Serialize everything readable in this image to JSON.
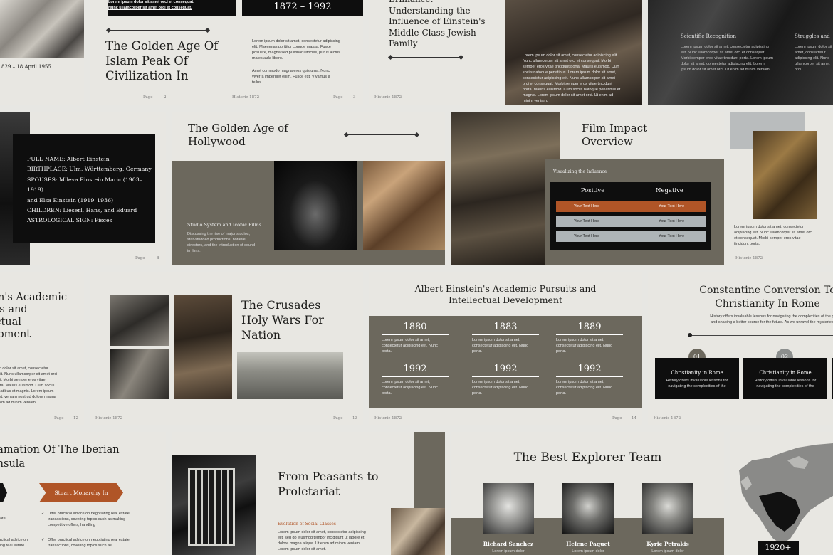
{
  "s1": {
    "date": "829 – 18 April 1955"
  },
  "s2": {
    "banner1": "Lorem ipsum dolor sit amet orci et consequat.",
    "banner2": "Nunc ullamcorper sit amet orci et consequat.",
    "title": "The Golden Age Of Islam Peak Of Civilization In",
    "page": "Page",
    "num": "2"
  },
  "s3": {
    "years": "1872 – 1992",
    "p1": "Lorem ipsum dolor sit amet, consectetur adipiscing elit. Maecenas porttitor congue massa. Fusce posuere, magna sed pulvinar ultricies, purus lectus malesuada libero.",
    "p2": "Amet commodo magna eros quis urna. Nunc viverra imperdiet enim. Fusce est. Vivamus a tellus.",
    "brand": "Historic 1872",
    "page": "Page",
    "num": "3"
  },
  "s4": {
    "title": "Brilliance: Understanding the Influence of Einstein's Middle-Class Jewish Family",
    "body": "Lorem ipsum dolor sit amet, consectetur adipiscing elit. Nunc ullamcorper sit amet orci et consequat. Morbi semper eros vitae tincidunt porta. Mauris euismod. Cum sociis natoque penatibus. Lorem ipsum dolor sit amet, consectetur adipiscing elit. Nunc ullamcorper sit amet orci et consequat. Morbi semper eros vitae tincidunt porta. Mauris euismod. Cum sociis natoque penatibus et magnis. Lorem ipsum dolor sit amet orci. Ut enim ad minim veniam.",
    "brand": "Historic 1872"
  },
  "s5": {
    "h1": "Scientific Recognition",
    "h2": "Struggles and",
    "b1": "Lorem ipsum dolor sit amet, consectetur adipiscing elit. Nunc ullamcorper sit amet orci et consequat. Morbi semper eros vitae tincidunt porta. Lorem ipsum dolor sit amet, consectetur adipiscing elit. Lorem ipsum dolor sit amet orci. Ut enim ad minim veniam.",
    "b2": "Lorem ipsum dolor sit amet, consectetur adipiscing elit. Nunc ullamcorper sit amet orci."
  },
  "s6": {
    "lines": [
      "FULL NAME: Albert Einstein",
      "BIRTHPLACE: Ulm, Württemberg, Germany",
      "SPOUSES:  Mileva Einstein Maric (1903–1919)",
      "and Elsa Einstein (1919–1936)",
      "CHILDREN: Lieserl, Hans, and Eduard",
      "ASTROLOGICAL SIGN: Pisces"
    ],
    "page": "Page",
    "num": "8"
  },
  "s7": {
    "title": "The Golden Age of Hollywood",
    "sub": "Studio System and Iconic Films",
    "body": "Discussing the rise of major studios, star-studded productions, notable directors, and the introduction of sound in films."
  },
  "s8": {
    "title": "Film Impact Overview",
    "label": "Visualizing the Influence",
    "pos": "Positive",
    "neg": "Negative",
    "cell": "Your Text Here"
  },
  "s9": {
    "body": "Lorem ipsum dolor sit amet, consectetur adipiscing elit. Nunc ullamcorper sit amet orci et consequat. Morbi semper eros vitae tincidunt porta.",
    "brand": "Historic 1872"
  },
  "s10": {
    "title": "Einstein's Academic Pursuits and Intellectual Development",
    "body": "Lorem ipsum dolor sit amet, consectetur adipiscing elit. Nunc ullamcorper sit amet orci et consequat. Morbi semper eros vitae tincidunt porta. Mauris euismod. Cum sociis natoque penatibus et magnis. Lorem ipsum dolor sit amet, veniam nostrud dolore magna aliqua. Ut enim ad minim veniam.",
    "page": "Page",
    "num": "12"
  },
  "s11": {
    "title": "The Crusades Holy Wars For Nation",
    "brand": "Historic 1872",
    "page": "Page",
    "num": "13"
  },
  "s12": {
    "title": "Albert Einstein's Academic Pursuits and Intellectual Development",
    "years": [
      "1880",
      "1883",
      "1889",
      "1992",
      "1992",
      "1992"
    ],
    "cap": "Lorem ipsum dolor sit amet, consectetur adipiscing elit. Nunc porta.",
    "brand": "Historic 1872",
    "page": "Page",
    "num": "14"
  },
  "s13": {
    "title": "Constantine Conversion To Christianity In Rome",
    "intro": "History offers invaluable lessons for navigating the complexities of the present and shaping a better course for the future. As we unravel the mysteries of the",
    "n1": "01",
    "n2": "02",
    "c1": "Christianity in Rome",
    "c2": "Christianity in Rome",
    "cb": "History offers invaluable lessons for navigating the complexities of the",
    "brand": "Historic 1872"
  },
  "s14": {
    "title": "Reclamation Of The Iberian Peninsula",
    "tag": "Stuart Monarchy In",
    "b1": "Offer practical advice on negotiating real estate transactions, covering topics such as making competitive offers, handling",
    "b2": "Offer practical advice on negotiating real estate transactions, covering topics such as",
    "left1": "ate",
    "left2": "Offer practical advice on negotiating real estate"
  },
  "s15": {
    "title": "From Peasants to Proletariat",
    "sub": "Evolution of Social Classes",
    "body": "Lorem ipsum dolor sit amet, consectetur adipiscing elit, sed do eiusmod tempor incididunt ut labore et dolore magna aliqua. Ut enim ad minim veniam. Lorem ipsum dolor sit amet."
  },
  "s16": {
    "title": "The Best Explorer Team",
    "names": [
      "Richard Sanchez",
      "Helene Paquet",
      "Kyrie Petrakis"
    ],
    "role": "Lorem ipsum dolor"
  },
  "s17": {
    "year": "1920+"
  }
}
